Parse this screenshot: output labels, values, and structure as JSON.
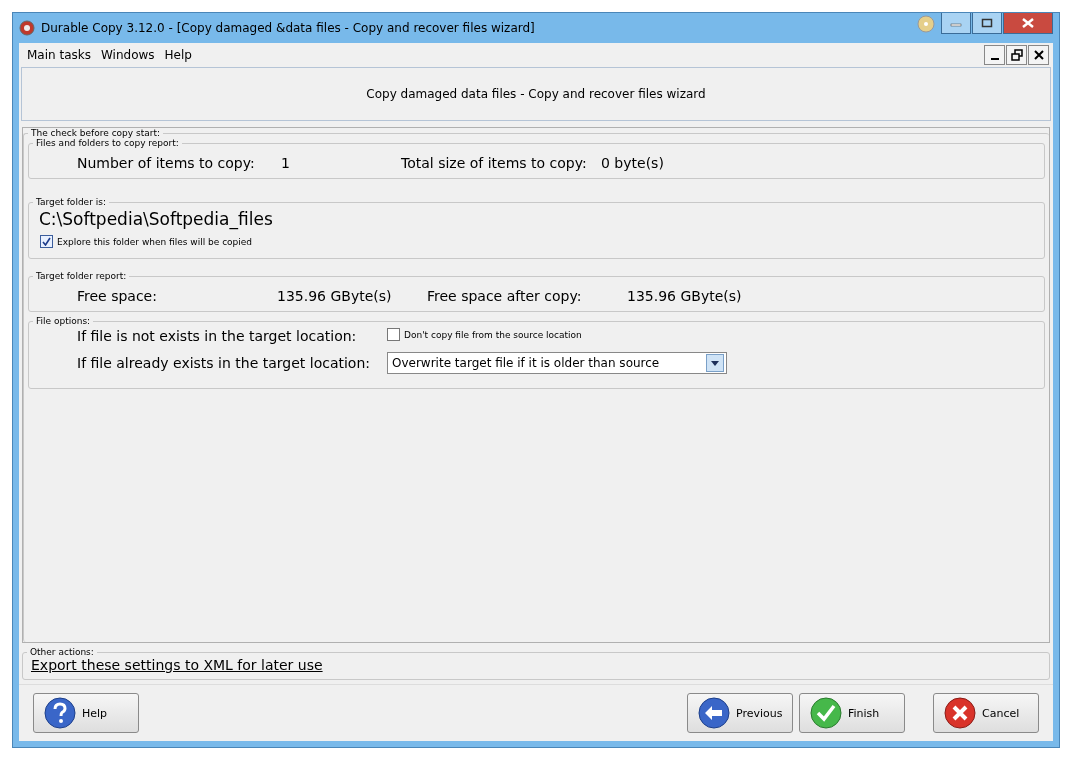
{
  "window": {
    "title": "Durable Copy 3.12.0 - [Copy damaged &data files - Copy and recover files wizard]"
  },
  "menu": [
    "Main tasks",
    "Windows",
    "Help"
  ],
  "header": {
    "title": "Copy damaged data files - Copy and recover files wizard"
  },
  "check": {
    "legend": "The check before copy start:",
    "report": {
      "legend": "Files and folders to copy report:",
      "items_label": "Number of items to copy:",
      "items_value": "1",
      "size_label": "Total size of items to copy:",
      "size_value": "0 byte(s)"
    },
    "target": {
      "legend": "Target folder is:",
      "path": "C:\\Softpedia\\Softpedia_files",
      "explore": {
        "label": "Explore this folder when files will be copied",
        "checked": true
      }
    },
    "folder_report": {
      "legend": "Target folder report:",
      "free_label": "Free space:",
      "free_value": "135.96 GByte(s)",
      "after_label": "Free space after copy:",
      "after_value": "135.96 GByte(s)"
    },
    "options": {
      "legend": "File options:",
      "not_exists_label": "If file is not exists in the target location:",
      "dont_copy": {
        "label": "Don't copy file from the source location",
        "checked": false
      },
      "exists_label": "If file already exists in the target location:",
      "exists_value": "Overwrite target file if it is older than source"
    }
  },
  "other": {
    "legend": "Other actions:",
    "link": "Export these settings to XML for later use"
  },
  "buttons": [
    {
      "kind": "help",
      "label": "Help"
    },
    {
      "kind": "previous",
      "label": "Previous"
    },
    {
      "kind": "finish",
      "label": "Finish"
    },
    {
      "kind": "cancel",
      "label": "Cancel"
    }
  ]
}
